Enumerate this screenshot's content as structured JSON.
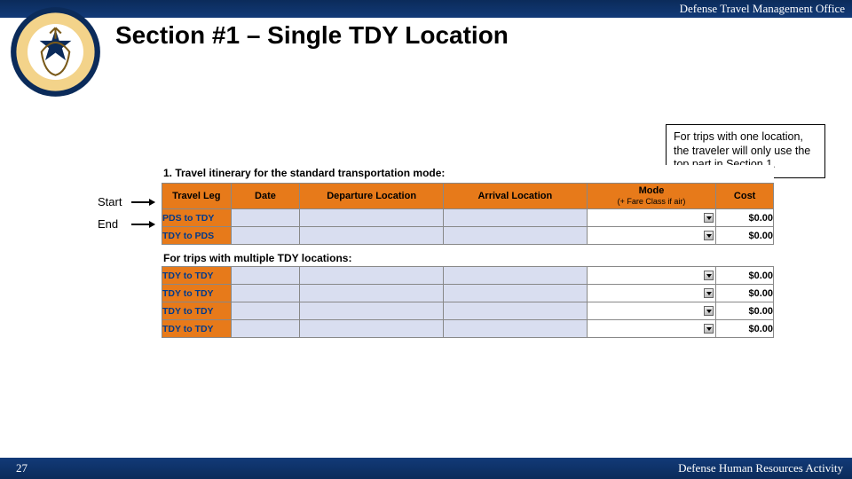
{
  "header": {
    "org": "Defense Travel Management Office"
  },
  "title": "Section #1 – Single TDY Location",
  "callout": "For trips with one location, the traveler will only use the top part in Section 1.",
  "labels": {
    "start": "Start",
    "end": "End"
  },
  "form": {
    "heading": "1. Travel itinerary for the standard transportation mode:",
    "columns": {
      "leg": "Travel Leg",
      "date": "Date",
      "dep": "Departure Location",
      "arr": "Arrival Location",
      "mode": "Mode",
      "mode_sub": "(+ Fare Class if air)",
      "cost": "Cost"
    },
    "rows_primary": [
      {
        "leg": "PDS to TDY",
        "cost": "$0.00"
      },
      {
        "leg": "TDY to PDS",
        "cost": "$0.00"
      }
    ],
    "subheading": "For trips with multiple TDY locations:",
    "rows_multi": [
      {
        "leg": "TDY to TDY",
        "cost": "$0.00"
      },
      {
        "leg": "TDY to TDY",
        "cost": "$0.00"
      },
      {
        "leg": "TDY to TDY",
        "cost": "$0.00"
      },
      {
        "leg": "TDY to TDY",
        "cost": "$0.00"
      }
    ]
  },
  "footer": {
    "page": "27",
    "org": "Defense Human Resources Activity"
  }
}
